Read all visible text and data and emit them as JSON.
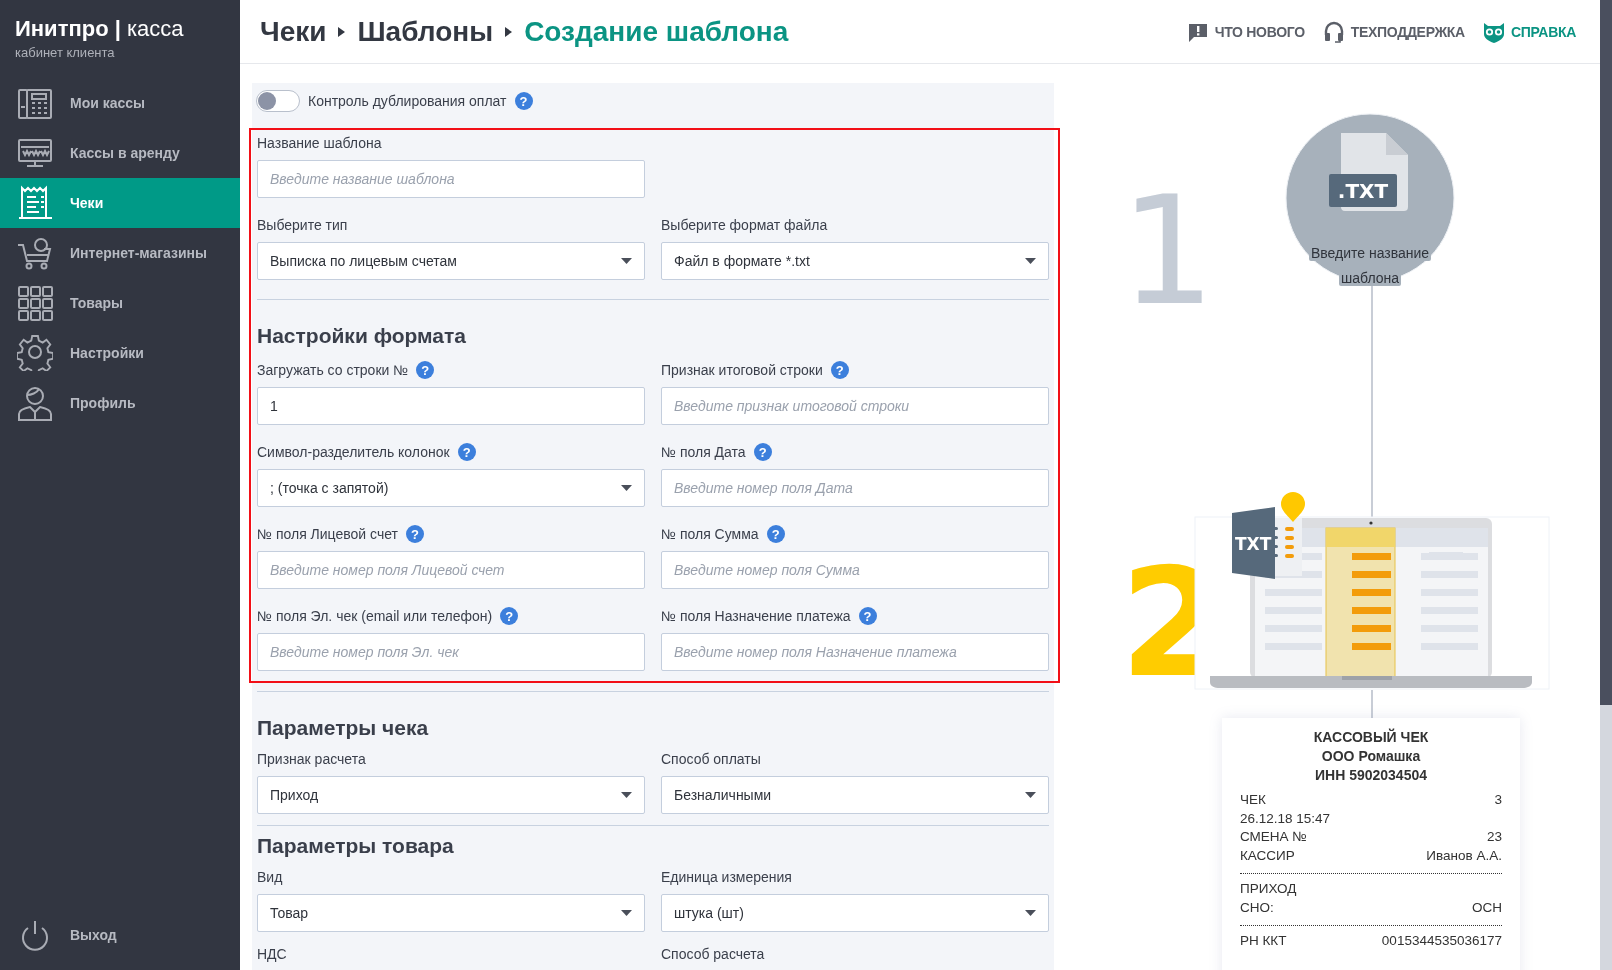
{
  "brand": {
    "name": "**Инитпро |** касса",
    "subtitle": "кабинет клиента"
  },
  "sidebar": {
    "items": [
      {
        "label": "Мои кассы",
        "kind": "register",
        "selected": false
      },
      {
        "label": "Кассы в аренду",
        "kind": "monitor",
        "selected": false
      },
      {
        "label": "Чеки",
        "kind": "receipt",
        "selected": true
      },
      {
        "label": "Интернет-магазины",
        "kind": "cart",
        "selected": false
      },
      {
        "label": "Товары",
        "kind": "grid",
        "selected": false
      },
      {
        "label": "Настройки",
        "kind": "gear",
        "selected": false
      },
      {
        "label": "Профиль",
        "kind": "person",
        "selected": false
      }
    ],
    "logout": "Выход"
  },
  "breadcrumbs": [
    {
      "label": "Чеки",
      "current": false
    },
    {
      "label": "Шаблоны",
      "current": false
    },
    {
      "label": "Создание шаблона",
      "current": true
    }
  ],
  "header_links": [
    {
      "label": "ЧТО НОВОГО",
      "kind": "news",
      "accent": false
    },
    {
      "label": "ТЕХПОДДЕРЖКА",
      "kind": "support",
      "accent": false
    },
    {
      "label": "СПРАВКА",
      "kind": "help",
      "accent": true
    }
  ],
  "duplicate_control": {
    "label": "Контроль дублирования оплат",
    "on": false,
    "help": "?"
  },
  "template": {
    "highlighted": true,
    "sections": [
      {
        "rows": [
          [
            {
              "label": "Название шаблона",
              "kind": "text",
              "placeholder": "Введите название шаблона"
            }
          ],
          [
            {
              "label": "Выберите тип",
              "kind": "select",
              "value": "Выписка по лицевым счетам"
            },
            {
              "label": "Выберите формат файла",
              "kind": "select",
              "value": "Файл в формате *.txt"
            }
          ]
        ]
      },
      {
        "title": "Настройки формата",
        "rows": [
          [
            {
              "label": "Загружать со строки №",
              "help": "?",
              "kind": "text",
              "value": "1"
            },
            {
              "label": "Признак итоговой строки",
              "help": "?",
              "kind": "text",
              "placeholder": "Введите признак итоговой строки"
            }
          ],
          [
            {
              "label": "Символ-разделитель колонок",
              "help": "?",
              "kind": "select",
              "value": "; (точка с запятой)"
            },
            {
              "label": "№ поля Дата",
              "help": "?",
              "kind": "text",
              "placeholder": "Введите номер поля Дата"
            }
          ],
          [
            {
              "label": "№ поля Лицевой счет",
              "help": "?",
              "kind": "text",
              "placeholder": "Введите номер поля Лицевой счет"
            },
            {
              "label": "№ поля Сумма",
              "help": "?",
              "kind": "text",
              "placeholder": "Введите номер поля Сумма"
            }
          ],
          [
            {
              "label": "№ поля Эл. чек (email или телефон)",
              "help": "?",
              "kind": "text",
              "placeholder": "Введите номер поля Эл. чек"
            },
            {
              "label": "№ поля Назначение платежа",
              "help": "?",
              "kind": "text",
              "placeholder": "Введите номер поля Назначение платежа"
            }
          ]
        ]
      }
    ]
  },
  "sections": [
    {
      "title": "Параметры чека",
      "rows": [
        [
          {
            "label": "Признак расчета",
            "kind": "select",
            "value": "Приход"
          },
          {
            "label": "Способ оплаты",
            "kind": "select",
            "value": "Безналичными"
          }
        ]
      ]
    },
    {
      "title": "Параметры товара",
      "rows": [
        [
          {
            "label": "Вид",
            "kind": "select",
            "value": "Товар"
          },
          {
            "label": "Единица измерения",
            "kind": "select",
            "value": "штука (шт)"
          }
        ],
        [
          {
            "label": "НДС"
          },
          {
            "label": "Способ расчета"
          }
        ]
      ]
    }
  ],
  "illustration": {
    "steps": [
      {
        "number": "1",
        "active": false
      },
      {
        "number": "2",
        "active": true
      }
    ],
    "file_badge": ".TXT",
    "caption_lines": [
      "Введите название",
      "шаблона"
    ],
    "laptop_badge": "TXT",
    "receipt": {
      "title_lines": [
        "КАССОВЫЙ ЧЕК",
        "ООО Ромашка",
        "ИНН 5902034504"
      ],
      "groups": [
        [
          {
            "label": "ЧЕК",
            "value": "3"
          },
          {
            "label": "26.12.18 15:47"
          },
          {
            "label": "СМЕНА №",
            "value": "23"
          },
          {
            "label": "КАССИР",
            "value": "Иванов А.А."
          }
        ],
        [
          {
            "label": "ПРИХОД"
          },
          {
            "label": "СНО:",
            "value": "ОСН"
          }
        ],
        [
          {
            "label": "РН ККТ",
            "value": "0015344535036177"
          }
        ]
      ]
    }
  }
}
